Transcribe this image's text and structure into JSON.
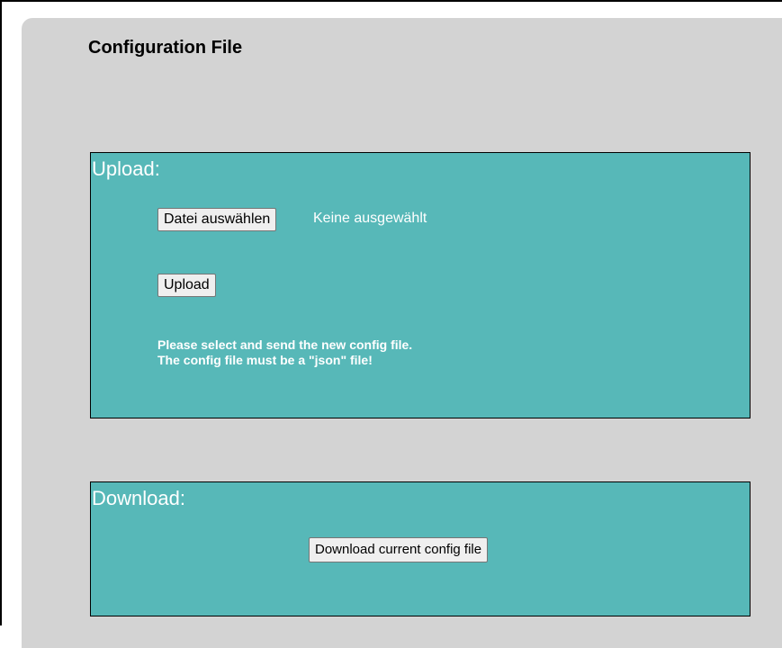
{
  "page": {
    "title": "Configuration File"
  },
  "upload": {
    "heading": "Upload:",
    "choose_file_label": "Datei auswählen",
    "file_status": "Keine ausgewählt",
    "upload_label": "Upload",
    "hint_line1": "Please select and send the new config file.",
    "hint_line2": "The config file must be a \"json\" file!"
  },
  "download": {
    "heading": "Download:",
    "download_label": "Download current config file"
  },
  "colors": {
    "panel_background": "#d3d3d3",
    "section_background": "#57b8b8",
    "section_text": "#ffffff"
  }
}
